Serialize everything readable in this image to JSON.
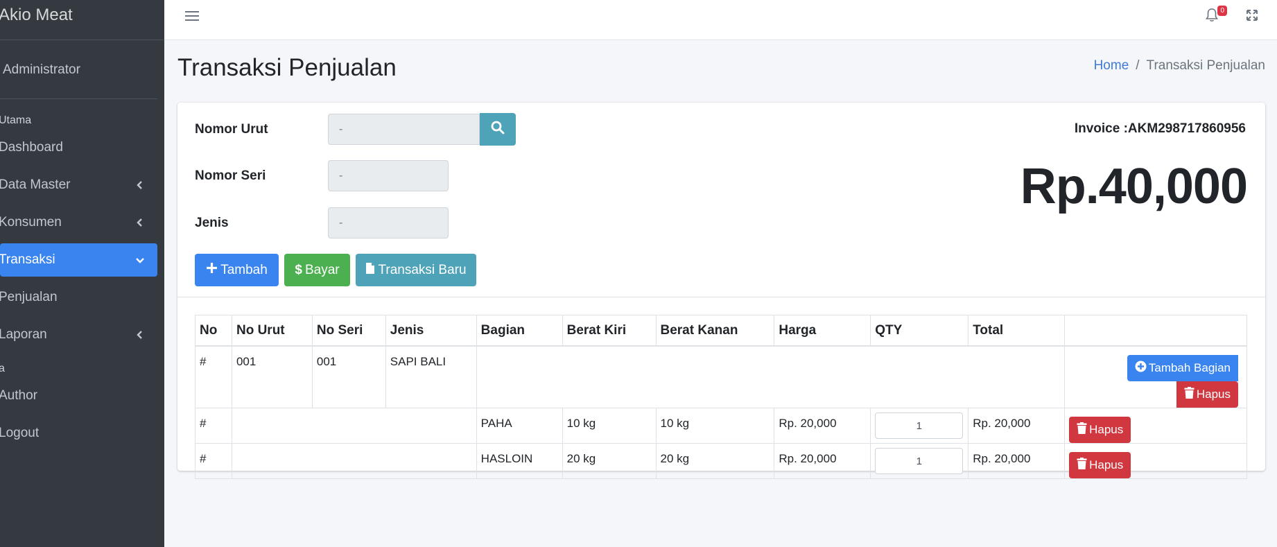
{
  "brand": {
    "name": "Akio Meat"
  },
  "user": {
    "name": "Administrator"
  },
  "sidebar": {
    "header_main": "Utama",
    "items": [
      {
        "label": "Dashboard"
      },
      {
        "label": "Data Master"
      },
      {
        "label": "Konsumen"
      },
      {
        "label": "Transaksi"
      },
      {
        "label": "Penjualan"
      },
      {
        "label": "Laporan"
      }
    ],
    "header_other": "a",
    "items2": [
      {
        "label": "Author"
      },
      {
        "label": "Logout"
      }
    ]
  },
  "topbar": {
    "notification_count": "0"
  },
  "page": {
    "title": "Transaksi Penjualan",
    "breadcrumb_home": "Home",
    "breadcrumb_sep": "/",
    "breadcrumb_current": "Transaksi Penjualan"
  },
  "form": {
    "nomor_urut_label": "Nomor Urut",
    "nomor_urut_value": "-",
    "nomor_seri_label": "Nomor Seri",
    "nomor_seri_value": "-",
    "jenis_label": "Jenis",
    "jenis_value": "-"
  },
  "invoice": {
    "label": "Invoice :",
    "number": "AKM298717860956",
    "total": "Rp.40,000"
  },
  "buttons": {
    "tambah": "Tambah",
    "bayar": "Bayar",
    "transaksi_baru": "Transaksi Baru"
  },
  "table": {
    "headers": [
      "No",
      "No Urut",
      "No Seri",
      "Jenis",
      "Bagian",
      "Berat Kiri",
      "Berat Kanan",
      "Harga",
      "QTY",
      "Total",
      ""
    ],
    "group": {
      "no": "#",
      "no_urut": "001",
      "no_seri": "001",
      "jenis": "SAPI BALI",
      "tambah_bagian": "Tambah Bagian",
      "hapus": "Hapus"
    },
    "rows": [
      {
        "no": "#",
        "bagian": "PAHA",
        "berat_kiri": "10 kg",
        "berat_kanan": "10 kg",
        "harga": "Rp. 20,000",
        "qty": "1",
        "total": "Rp. 20,000",
        "hapus": "Hapus"
      },
      {
        "no": "#",
        "bagian": "HASLOIN",
        "berat_kiri": "20 kg",
        "berat_kanan": "20 kg",
        "harga": "Rp. 20,000",
        "qty": "1",
        "total": "Rp. 20,000",
        "hapus": "Hapus"
      }
    ]
  },
  "colors": {
    "primary": "#3a84f0",
    "success": "#4caf50",
    "info": "#4fa3b8",
    "danger": "#d0373f",
    "sidebar": "#343a40"
  }
}
